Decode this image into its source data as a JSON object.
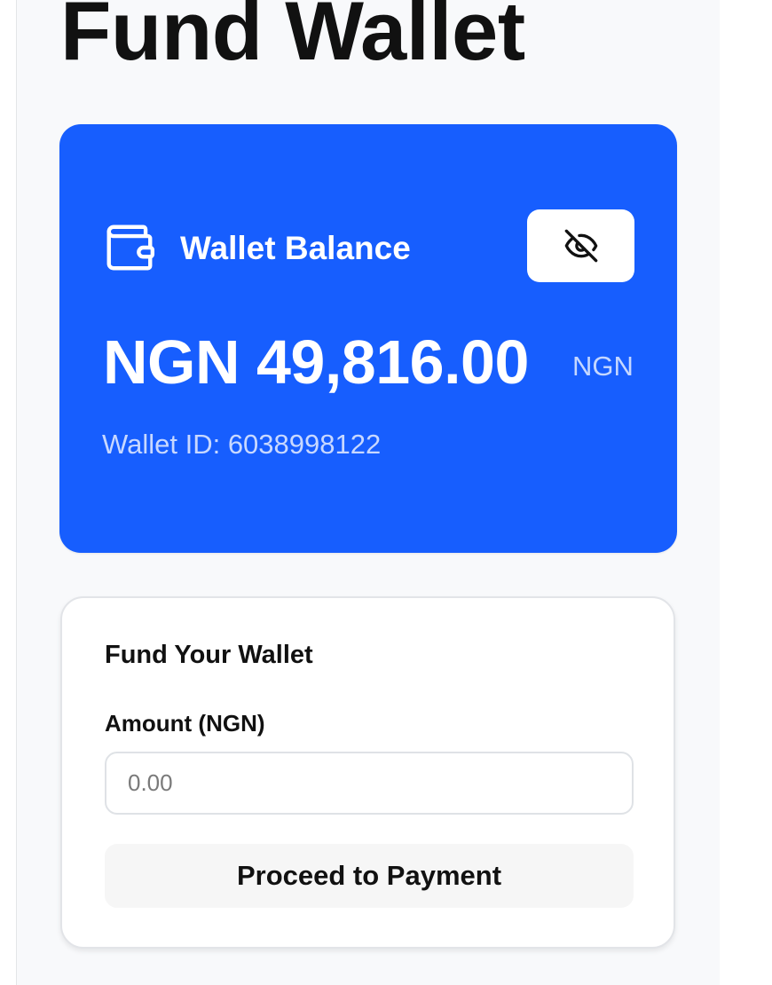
{
  "page": {
    "title": "Fund Wallet"
  },
  "balance_card": {
    "label": "Wallet Balance",
    "amount": "NGN 49,816.00",
    "currency": "NGN",
    "wallet_id": "Wallet ID: 6038998122",
    "icon": "wallet-icon",
    "toggle_icon": "eye-off-icon",
    "background_color": "#175efe"
  },
  "fund_form": {
    "title": "Fund Your Wallet",
    "amount_label": "Amount (NGN)",
    "amount_value": "",
    "amount_placeholder": "0.00",
    "submit_label": "Proceed to Payment"
  }
}
